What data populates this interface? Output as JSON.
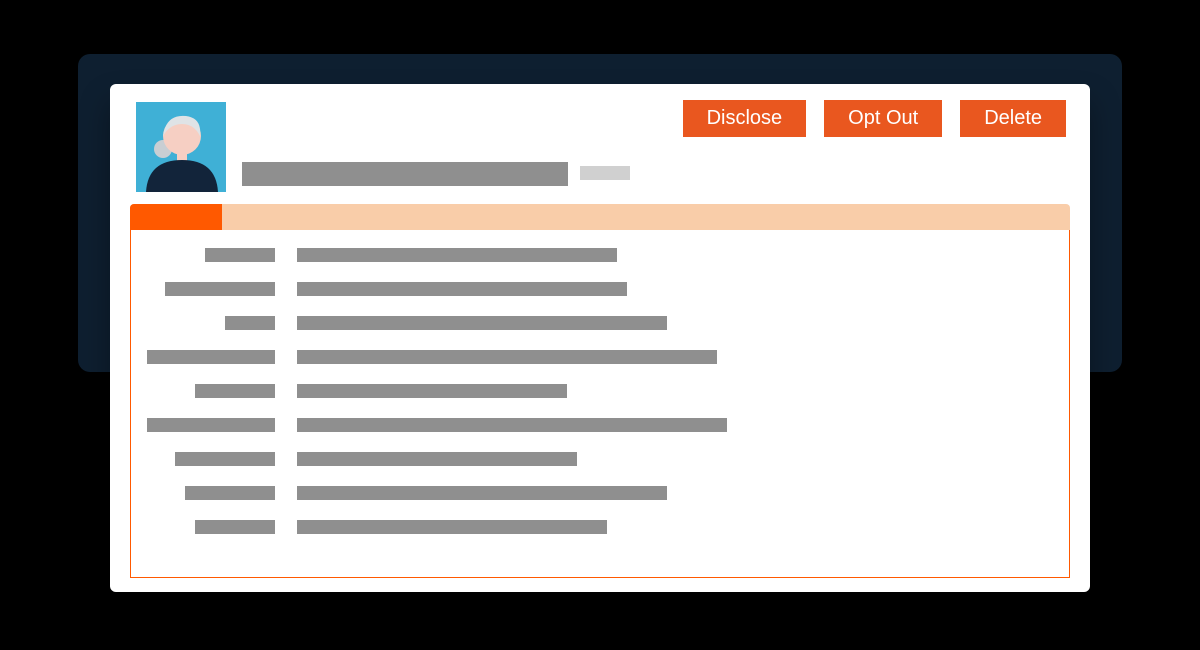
{
  "colors": {
    "button_bg": "#e9571f",
    "tab_active": "#ff5900",
    "tab_strip": "#f9cda9",
    "placeholder": "#8f8f8f",
    "avatar_bg": "#3fb0d6",
    "dark_panel": "#0e1f30"
  },
  "actions": {
    "disclose": "Disclose",
    "opt_out": "Opt Out",
    "delete": "Delete"
  },
  "profile": {
    "name_placeholder_width": 326,
    "sub_placeholder_width": 50
  },
  "tabs": {
    "active_index": 0
  },
  "rows": [
    {
      "label_width": 70,
      "value_width": 320
    },
    {
      "label_width": 110,
      "value_width": 330
    },
    {
      "label_width": 50,
      "value_width": 370
    },
    {
      "label_width": 130,
      "value_width": 420
    },
    {
      "label_width": 80,
      "value_width": 270
    },
    {
      "label_width": 150,
      "value_width": 430
    },
    {
      "label_width": 100,
      "value_width": 280
    },
    {
      "label_width": 90,
      "value_width": 370
    },
    {
      "label_width": 80,
      "value_width": 310
    }
  ]
}
